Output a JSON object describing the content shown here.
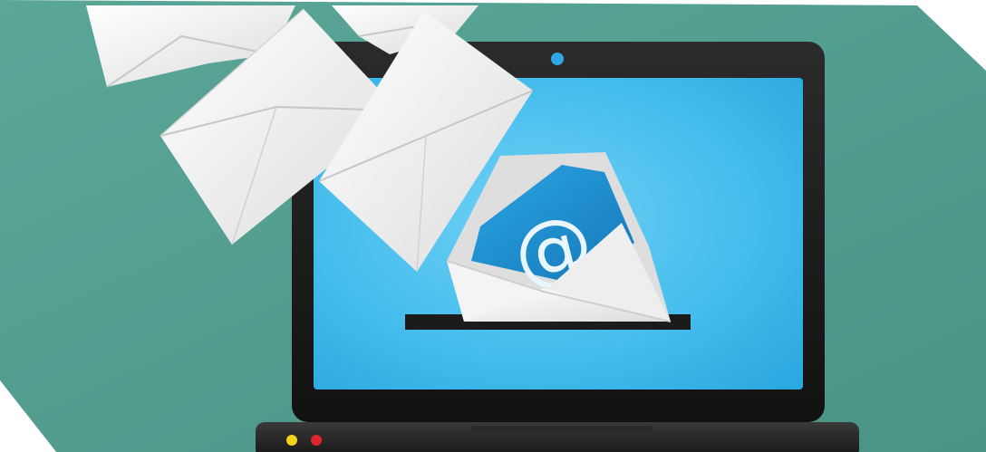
{
  "illustration": {
    "email_symbol": "@",
    "icons": [
      "laptop-icon",
      "envelope-icon",
      "email-at-icon"
    ],
    "colors": {
      "background": "#4f9a8d",
      "screen": "#3fb7ea",
      "laptop_frame": "#1c1c1c",
      "envelope": "#f2f2f2",
      "letter": "#1e8fd0",
      "indicator_yellow": "#f2d21b",
      "indicator_red": "#e0262a",
      "camera": "#2ea7e6"
    }
  }
}
